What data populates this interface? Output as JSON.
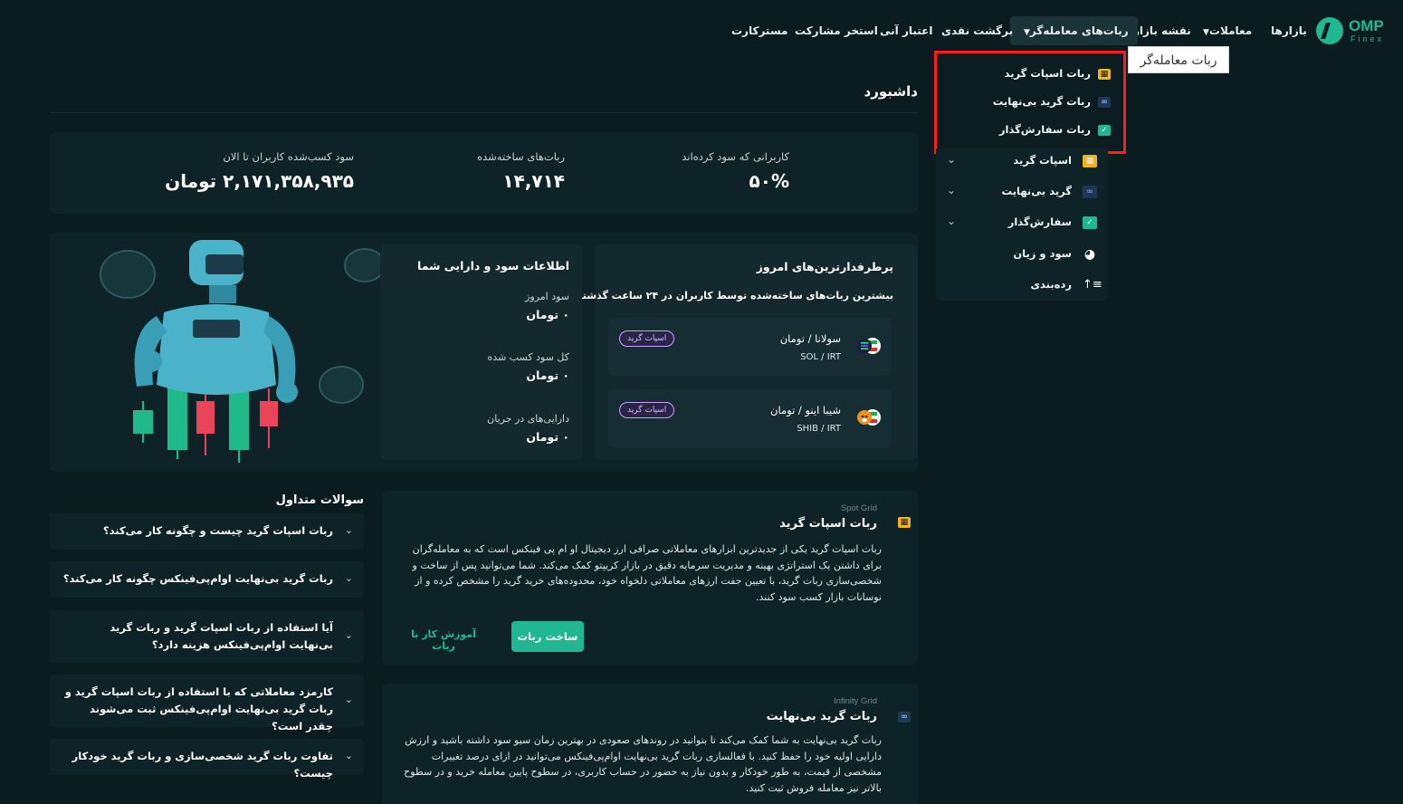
{
  "brand": {
    "name": "OMP",
    "sub": "Finex"
  },
  "nav": {
    "items": [
      "بازارها",
      "معاملات",
      "نقشه بازار",
      "ربات‌های معامله‌گر",
      "برگشت نقدی",
      "اعتبار آنی",
      "استخر مشارکت",
      "مسترکارت"
    ]
  },
  "tooltip": "ربات معامله‌گر",
  "dropdown": {
    "items": [
      "ربات اسپات گرید",
      "ربات گرید بی‌نهایت",
      "ربات سفارش‌گذار"
    ]
  },
  "sidebar": {
    "items": [
      "اسپات گرید",
      "گرید بی‌نهایت",
      "سفارش‌گذار",
      "سود و زیان",
      "رده‌بندی"
    ]
  },
  "page": {
    "title": "داشبورد"
  },
  "stats": {
    "profitable_users_label": "کاربرانی که سود کرده‌اند",
    "profitable_users_value": "۵۰%",
    "bots_created_label": "ربات‌های ساخته‌شده",
    "bots_created_value": "۱۴,۷۱۴",
    "total_profit_label": "سود کسب‌شده کاربران تا الان",
    "total_profit_value": "۲,۱۷۱,۳۵۸,۹۳۵ تومان"
  },
  "top_bots": {
    "title": "پرطرفدارترین‌های امروز",
    "subtitle": "بیشترین ربات‌های ساخته‌شده توسط کاربران در ۲۴ ساعت گذشته",
    "pairs": [
      {
        "name": "سولانا / تومان",
        "symbol": "SOL / IRT",
        "badge": "اسپات گرید"
      },
      {
        "name": "شیبا اینو / تومان",
        "symbol": "SHIB / IRT",
        "badge": "اسپات گرید"
      }
    ]
  },
  "profit_info": {
    "title": "اطلاعات سود و دارایی شما",
    "today_label": "سود امروز",
    "today_value": "۰ تومان",
    "total_label": "کل سود کسب شده",
    "total_value": "۰ تومان",
    "assets_label": "دارایی‌های در جریان",
    "assets_value": "۰ تومان"
  },
  "spot_grid": {
    "en": "Spot Grid",
    "title": "ربات اسپات گرید",
    "body": "ربات اسپات گرید یکی از جدیدترین ابزارهای معاملاتی صرافی ارز دیجیتال او ام پی فینکس است که به معامله‌گران برای داشتن یک استراتژی بهینه و مدیریت سرمایه دقیق در بازار کریپتو کمک می‌کند. شما می‌توانید پس از ساخت و شخصی‌سازی ربات گرید، با تعیین جفت ارزهای معاملاتی دلخواه خود، محدوده‌های خرید گرید را مشخص کرده و از نوسانات بازار کسب سود کنند.",
    "build_label": "ساخت ربات",
    "learn_label": "آموزش کار با ربات"
  },
  "infinity_grid": {
    "en": "Infinity Grid",
    "title": "ربات گرید بی‌نهایت",
    "body": "ربات گرید بی‌نهایت به شما کمک می‌کند تا بتوانید در روندهای صعودی در بهترین زمان سیو سود داشته باشید و ارزش دارایی اولیه خود را حفظ کنید. با فعالسازی ربات گرید بی‌نهایت اوام‌پی‌فینکس می‌توانید در ازای درصد تغییرات مشخصی از قیمت، به طور خودکار و بدون نیاز به حضور در حساب کاربری، در سطوح پایین معامله خرید و در سطوح بالاتر نیز معامله فروش ثبت کنید."
  },
  "faq": {
    "title": "سوالات متداول",
    "items": [
      "ربات اسپات گرید چیست و چگونه کار می‌کند؟",
      "ربات گرید بی‌نهایت اوام‌پی‌فینکس چگونه کار می‌کند؟",
      "آیا استفاده از ربات اسپات گرید و ربات گرید بی‌نهایت اوام‌پی‌فینکس هزینه دارد؟",
      "کارمزد معاملاتی که با استفاده از ربات اسپات گرید و ربات گرید بی‌نهایت اوام‌پی‌فینکس ثبت می‌شوند چقدر است؟",
      "تفاوت ربات گرید شخصی‌سازی و ربات گرید خودکار چیست؟"
    ]
  },
  "colors": {
    "accent": "#1fb892",
    "background": "#0a1c20",
    "card": "#0e2327",
    "highlight": "#ff1c1c"
  }
}
